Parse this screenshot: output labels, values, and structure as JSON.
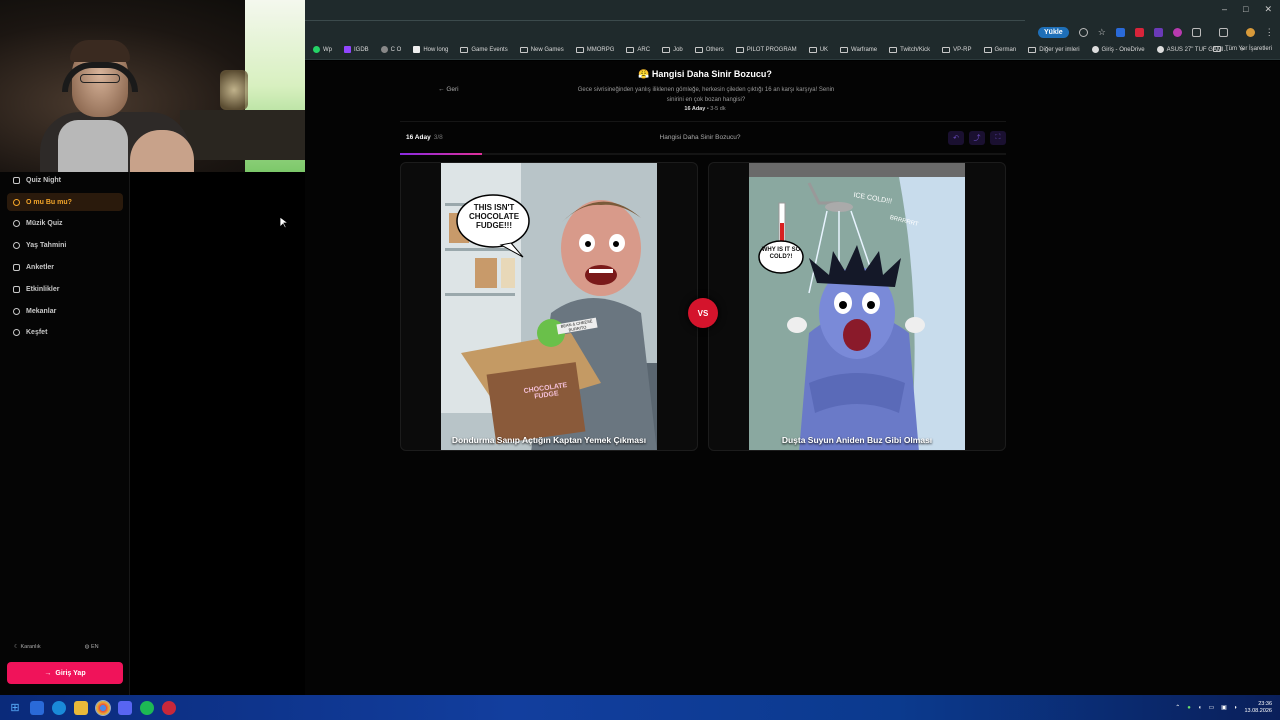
{
  "browser": {
    "update_label": "Yükle",
    "window_controls": [
      "–",
      "□",
      "✕"
    ],
    "bookmarks": [
      "Wp",
      "IGDB",
      "C O",
      "How long",
      "Game Events",
      "New Games",
      "MMORPG",
      "ARC",
      "Job",
      "Others",
      "PILOT PROGRAM",
      "UK",
      "Warframe",
      "Twitch/Kick",
      "VP-RP",
      "German",
      "Diğer yer imleri",
      "Giriş - OneDrive",
      "ASUS 27\" TUF GAMI..."
    ],
    "bookmarks_overflow": "»",
    "all_bookmarks": "Tüm Yer İşaretleri"
  },
  "sidebar": {
    "items": [
      {
        "label": "Quiz Night",
        "icon": "book-icon"
      },
      {
        "label": "O mu Bu mu?",
        "icon": "question-icon"
      },
      {
        "label": "Müzik Quiz",
        "icon": "headphones-icon"
      },
      {
        "label": "Yaş Tahmini",
        "icon": "people-icon"
      },
      {
        "label": "Anketler",
        "icon": "chart-icon"
      },
      {
        "label": "Etkinlikler",
        "icon": "calendar-icon"
      },
      {
        "label": "Mekanlar",
        "icon": "location-icon"
      },
      {
        "label": "Keşfet",
        "icon": "compass-icon"
      }
    ],
    "theme_label": "Karanlık",
    "lang_label": "EN",
    "login_label": "Giriş Yap"
  },
  "page": {
    "back_label": "Geri",
    "title_emoji": "😤",
    "title": "Hangisi Daha Sinir Bozucu?",
    "description": "Gece sivrisineğinden yanlış iliklenen gömleğe, herkesin çileden çıktığı 16 an karşı karşıya! Senin sinirini en çok bozan hangisi?",
    "meta_count": "16 Aday",
    "meta_time": "3-5 dk",
    "round_label": "16 Aday",
    "round_progress": "3/8",
    "bracket_title": "Hangisi Daha Sinir Bozucu?",
    "progress_fraction": 0.135,
    "vs_label": "VS"
  },
  "cards": [
    {
      "caption": "Dondurma Sanıp Açtığın Kaptan Yemek Çıkması",
      "bubble": "THIS ISN'T CHOCOLATE FUDGE!!!",
      "box_text": "CHOCOLATE FUDGE",
      "sticker": "BEAN & CHEESE BURRITO"
    },
    {
      "caption": "Duşta Suyun Aniden Buz Gibi Olması",
      "bubble": "WHY IS IT SO COLD?!",
      "shout": "ICE COLD!!!",
      "shout2": "BRRRRRT"
    }
  ],
  "taskbar": {
    "clock_time": "23:36",
    "clock_date": "13.08.2026"
  },
  "colors": {
    "accent_active": "#f4a62a",
    "login_button": "#f0135a",
    "vs_badge": "#d4142c",
    "progress": "#8a2be2"
  }
}
